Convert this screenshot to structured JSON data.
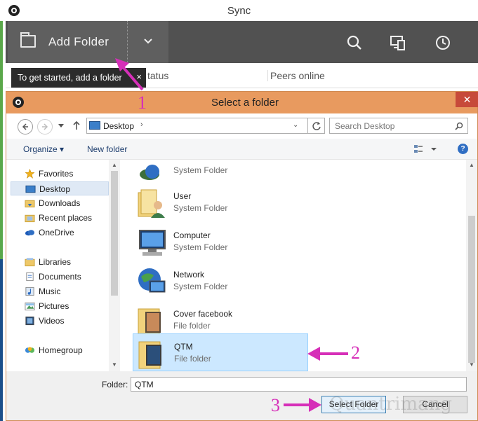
{
  "sync_window": {
    "title": "Sync",
    "add_folder_label": "Add Folder",
    "columns": {
      "status": "tatus",
      "peers_online": "Peers online"
    },
    "tooltip": {
      "text": "To get started, add a folder",
      "close": "×"
    }
  },
  "dialog": {
    "title": "Select a folder",
    "close": "✕",
    "address": {
      "location": "Desktop",
      "chevron": "›",
      "dropdown": "⌄"
    },
    "search_placeholder": "Search Desktop",
    "toolbar": {
      "organize": "Organize ▾",
      "new_folder": "New folder",
      "help": "?"
    },
    "nav_pane": {
      "favorites_label": "Favorites",
      "favorites": [
        "Desktop",
        "Downloads",
        "Recent places",
        "OneDrive"
      ],
      "libraries_label": "Libraries",
      "libraries": [
        "Documents",
        "Music",
        "Pictures",
        "Videos"
      ],
      "homegroup_label": "Homegroup"
    },
    "files": [
      {
        "name": "",
        "type": "System Folder"
      },
      {
        "name": "User",
        "type": "System Folder"
      },
      {
        "name": "Computer",
        "type": "System Folder"
      },
      {
        "name": "Network",
        "type": "System Folder"
      },
      {
        "name": "Cover facebook",
        "type": "File folder"
      },
      {
        "name": "QTM",
        "type": "File folder",
        "selected": true
      }
    ],
    "folder_label": "Folder:",
    "folder_value": "QTM",
    "select_button": "Select Folder",
    "cancel_button": "Cancel"
  },
  "annotations": {
    "step1": "1",
    "step2": "2",
    "step3": "3",
    "color": "#d62fb8"
  },
  "watermark": "Quantrimang"
}
